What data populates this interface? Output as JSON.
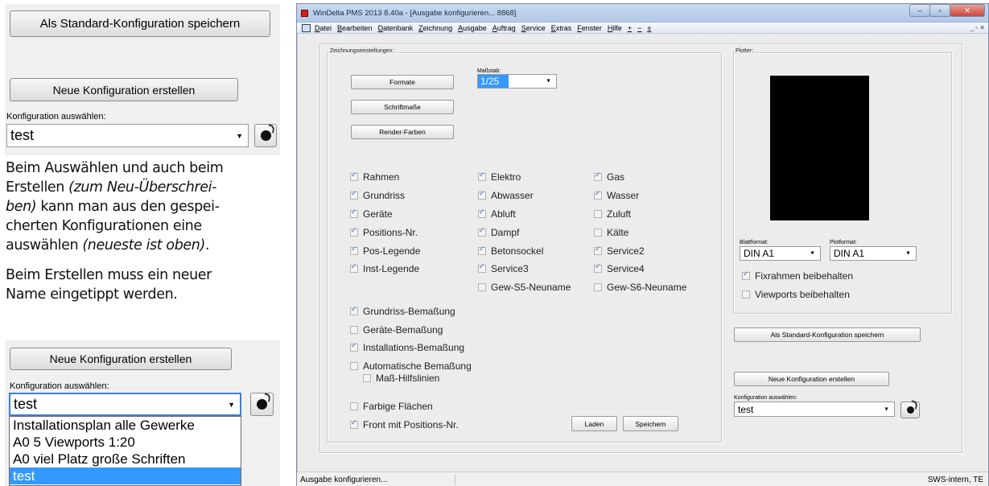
{
  "left": {
    "top_save_button": "Als Standard-Konfiguration speichern",
    "new_config_button": "Neue Konfiguration erstellen",
    "select_label": "Konfiguration auswählen:",
    "select_value": "test",
    "para1_a": "Beim Auswählen und auch beim",
    "para1_b": "Erstellen ",
    "para1_c": "(zum Neu-Überschrei-",
    "para1_d": "ben)",
    "para1_e": " kann man aus den gespei-",
    "para1_f": "cherten Konfigurationen eine",
    "para1_g": "auswählen ",
    "para1_h": "(neueste ist oben)",
    "para1_i": ".",
    "para2_a": "Beim Erstellen muss ein neuer",
    "para2_b": "Name eingetippt werden.",
    "bottom_new_config_button": "Neue Konfiguration erstellen",
    "bottom_select_label": "Konfiguration auswählen:",
    "bottom_select_value": "test",
    "dropdown_options": [
      "Installationsplan alle Gewerke",
      "A0 5 Viewports 1:20",
      "A0 viel Platz große Schriften",
      "test"
    ]
  },
  "window": {
    "title": "WinDelta PMS 2013 8.40a - [Ausgabe konfigurieren... 8868]",
    "menu": [
      "Datei",
      "Bearbeiten",
      "Datenbank",
      "Zeichnung",
      "Ausgabe",
      "Auftrag",
      "Service",
      "Extras",
      "Fenster",
      "Hilfe",
      "+",
      "−",
      "±"
    ],
    "zeichnung_label": "Zeichnungseinstellungen:",
    "btn_formate": "Formate",
    "btn_schriftmasse": "Schriftmaße",
    "btn_renderfarben": "Render-Farben",
    "massstab_label": "Maßstab:",
    "massstab_value": "1/25",
    "checkboxes_col1": [
      {
        "label": "Rahmen",
        "checked": true
      },
      {
        "label": "Grundriss",
        "checked": true
      },
      {
        "label": "Geräte",
        "checked": true
      },
      {
        "label": "Positions-Nr.",
        "checked": true
      },
      {
        "label": "Pos-Legende",
        "checked": true
      },
      {
        "label": "Inst-Legende",
        "checked": true
      }
    ],
    "checkboxes_col2": [
      {
        "label": "Elektro",
        "checked": true
      },
      {
        "label": "Abwasser",
        "checked": true
      },
      {
        "label": "Abluft",
        "checked": true
      },
      {
        "label": "Dampf",
        "checked": true
      },
      {
        "label": "Betonsockel",
        "checked": true
      },
      {
        "label": "Service3",
        "checked": true
      },
      {
        "label": "Gew-S5-Neuname",
        "checked": false
      }
    ],
    "checkboxes_col3": [
      {
        "label": "Gas",
        "checked": true
      },
      {
        "label": "Wasser",
        "checked": true
      },
      {
        "label": "Zuluft",
        "checked": false
      },
      {
        "label": "Kälte",
        "checked": false
      },
      {
        "label": "Service2",
        "checked": true
      },
      {
        "label": "Service4",
        "checked": true
      },
      {
        "label": "Gew-S6-Neuname",
        "checked": false
      }
    ],
    "checkboxes_lower": [
      {
        "label": "Grundriss-Bemaßung",
        "checked": true
      },
      {
        "label": "Geräte-Bemaßung",
        "checked": false
      },
      {
        "label": "Installations-Bemaßung",
        "checked": true
      },
      {
        "label": "Automatische Bemaßung",
        "checked": false
      }
    ],
    "cb_masshilfslinien": {
      "label": "Maß-Hilfslinien",
      "checked": false
    },
    "cb_farbige": {
      "label": "Farbige Flächen",
      "checked": false
    },
    "cb_front": {
      "label": "Front mit Positions-Nr.",
      "checked": true
    },
    "btn_laden": "Laden",
    "btn_speichern": "Speichern",
    "plotter_label": "Plotter:",
    "blattformat_label": "Blattformat:",
    "blattformat_value": "DIN A1",
    "plotformat_label": "Plotformat:",
    "plotformat_value": "DIN A1",
    "cb_fixrahmen": {
      "label": "Fixrahmen beibehalten",
      "checked": true
    },
    "cb_viewports": {
      "label": "Viewports beibehalten",
      "checked": false
    },
    "btn_standard": "Als Standard-Konfiguration speichern",
    "btn_neue": "Neue Konfiguration erstellen",
    "konfig_label": "Konfiguration auswählen:",
    "konfig_value": "test",
    "status_left": "Ausgabe konfigurieren...",
    "status_right": "SWS-intern, TE",
    "colors": {
      "titlebar": "#b3c8e6",
      "close": "#c9463d",
      "selection": "#3399ff"
    }
  }
}
